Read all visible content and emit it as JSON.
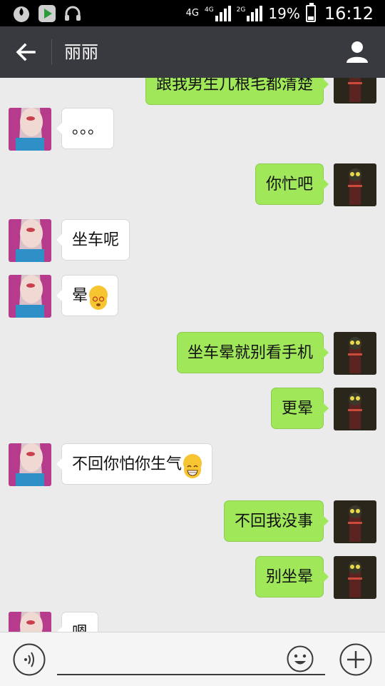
{
  "status_bar": {
    "network": "4G",
    "sig1_label": "4G",
    "sig2_label": "2G",
    "battery": "19%",
    "time": "16:12"
  },
  "header": {
    "title": "丽丽"
  },
  "messages": [
    {
      "side": "right",
      "text": "跟我男生几根毛都清楚"
    },
    {
      "side": "left",
      "text": "。。。"
    },
    {
      "side": "right",
      "text": "你忙吧"
    },
    {
      "side": "left",
      "text": "坐车呢"
    },
    {
      "side": "left",
      "text": "晕",
      "emoji": "dizzy-face-emoji"
    },
    {
      "side": "right",
      "text": "坐车晕就别看手机"
    },
    {
      "side": "right",
      "text": "更晕"
    },
    {
      "side": "left",
      "text": "不回你怕你生气",
      "emoji": "grinning-face-emoji"
    },
    {
      "side": "right",
      "text": "不回我没事"
    },
    {
      "side": "right",
      "text": "别坐晕"
    },
    {
      "side": "left",
      "text": "嗯"
    }
  ],
  "input": {
    "value": "",
    "placeholder": ""
  },
  "colors": {
    "title_bar": "#393a3f",
    "chat_background": "#ebebeb",
    "outgoing_bubble": "#a0e75a",
    "incoming_bubble": "#ffffff"
  }
}
